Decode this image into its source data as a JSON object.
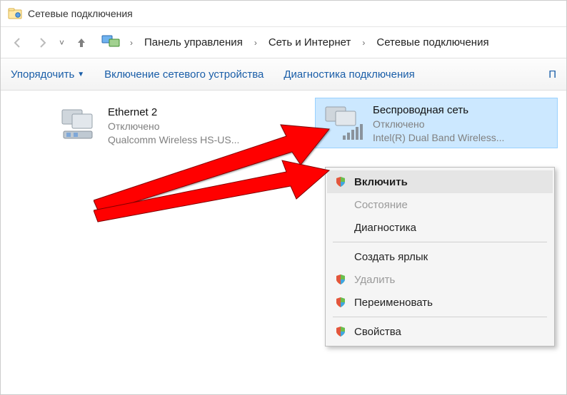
{
  "window": {
    "title": "Сетевые подключения"
  },
  "breadcrumb": {
    "items": [
      "Панель управления",
      "Сеть и Интернет",
      "Сетевые подключения"
    ]
  },
  "toolbar": {
    "organize": "Упорядочить",
    "enable_device": "Включение сетевого устройства",
    "diagnose": "Диагностика подключения",
    "more": "П"
  },
  "adapters": [
    {
      "name": "Ethernet 2",
      "status": "Отключено",
      "hw": "Qualcomm Wireless HS-US..."
    },
    {
      "name": "Беспроводная сеть",
      "status": "Отключено",
      "hw": "Intel(R) Dual Band Wireless..."
    }
  ],
  "context_menu": {
    "enable": "Включить",
    "state": "Состояние",
    "diagnostics": "Диагностика",
    "create_shortcut": "Создать ярлык",
    "delete": "Удалить",
    "rename": "Переименовать",
    "properties": "Свойства"
  }
}
